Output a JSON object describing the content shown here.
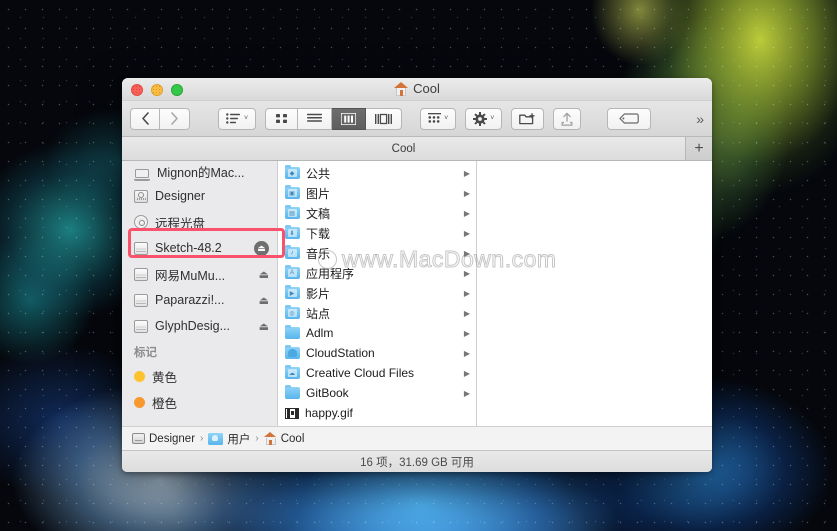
{
  "window": {
    "title": "Cool",
    "title_icon": "home-icon",
    "traffic_lights": [
      "close-red",
      "minimize-yellow",
      "zoom-green"
    ]
  },
  "toolbar": {
    "back_label": "‹",
    "forward_label": "›",
    "view_arrange_label": "list-arrange-icon",
    "view_icon_label": "icon-view-icon",
    "view_list_label": "list-view-icon",
    "view_column_label": "column-view-icon",
    "view_gallery_label": "gallery-view-icon",
    "group_label": "group-by-icon",
    "action_label": "gear-icon",
    "newfolder_label": "new-folder-icon",
    "share_label": "share-icon",
    "tags_label": "tag-icon",
    "overflow_label": "»",
    "caret": "˅"
  },
  "tabs": {
    "items": [
      {
        "label": "Cool",
        "active": true
      }
    ],
    "add_label": "+"
  },
  "sidebar": {
    "devices": [
      {
        "label": "Mignon的Mac...",
        "icon": "laptop-icon",
        "eject": false
      },
      {
        "label": "Designer",
        "icon": "server-icon",
        "eject": false
      },
      {
        "label": "远程光盘",
        "icon": "disc-icon",
        "eject": false
      },
      {
        "label": "Sketch-48.2",
        "icon": "drive-icon",
        "eject": true,
        "eject_style": "filled",
        "highlighted": true
      },
      {
        "label": "网易MuMu...",
        "icon": "drive-icon",
        "eject": true,
        "eject_style": "plain"
      },
      {
        "label": "Paparazzi!...",
        "icon": "drive-icon",
        "eject": true,
        "eject_style": "plain"
      },
      {
        "label": "GlyphDesig...",
        "icon": "drive-icon",
        "eject": true,
        "eject_style": "plain"
      }
    ],
    "tags_header": "标记",
    "tags": [
      {
        "label": "黄色",
        "color": "#fdc22e"
      },
      {
        "label": "橙色",
        "color": "#f7992e"
      }
    ],
    "eject_glyph": "⏏"
  },
  "files": {
    "items": [
      {
        "name": "公共",
        "icon": "folder-public",
        "arrow": true
      },
      {
        "name": "图片",
        "icon": "folder-pictures",
        "arrow": true
      },
      {
        "name": "文稿",
        "icon": "folder-documents",
        "arrow": true
      },
      {
        "name": "下载",
        "icon": "folder-downloads",
        "arrow": true
      },
      {
        "name": "音乐",
        "icon": "folder-music",
        "arrow": true
      },
      {
        "name": "应用程序",
        "icon": "folder-applications",
        "arrow": true
      },
      {
        "name": "影片",
        "icon": "folder-movies",
        "arrow": true
      },
      {
        "name": "站点",
        "icon": "folder-sites",
        "arrow": true
      },
      {
        "name": "Adlm",
        "icon": "folder-plain",
        "arrow": true
      },
      {
        "name": "CloudStation",
        "icon": "folder-cloudstation",
        "arrow": true
      },
      {
        "name": "Creative Cloud Files",
        "icon": "folder-creative-cloud",
        "arrow": true
      },
      {
        "name": "GitBook",
        "icon": "folder-plain",
        "arrow": true
      },
      {
        "name": "happy.gif",
        "icon": "gif-file",
        "arrow": false
      }
    ],
    "arrow_glyph": "▶"
  },
  "pathbar": {
    "segments": [
      {
        "label": "Designer",
        "icon": "hdd-icon"
      },
      {
        "label": "用户",
        "icon": "users-folder-icon"
      },
      {
        "label": "Cool",
        "icon": "home-icon"
      }
    ],
    "separator": "›"
  },
  "statusbar": {
    "text": "16 项，31.69 GB 可用"
  },
  "watermark": {
    "text": "www.MacDown.com"
  },
  "colors": {
    "highlight_rect": "#f8536a",
    "folder_blue": "#58b4ec",
    "tag_yellow": "#fdc22e",
    "tag_orange": "#f7992e",
    "selected_view": "#5e5e5e"
  }
}
